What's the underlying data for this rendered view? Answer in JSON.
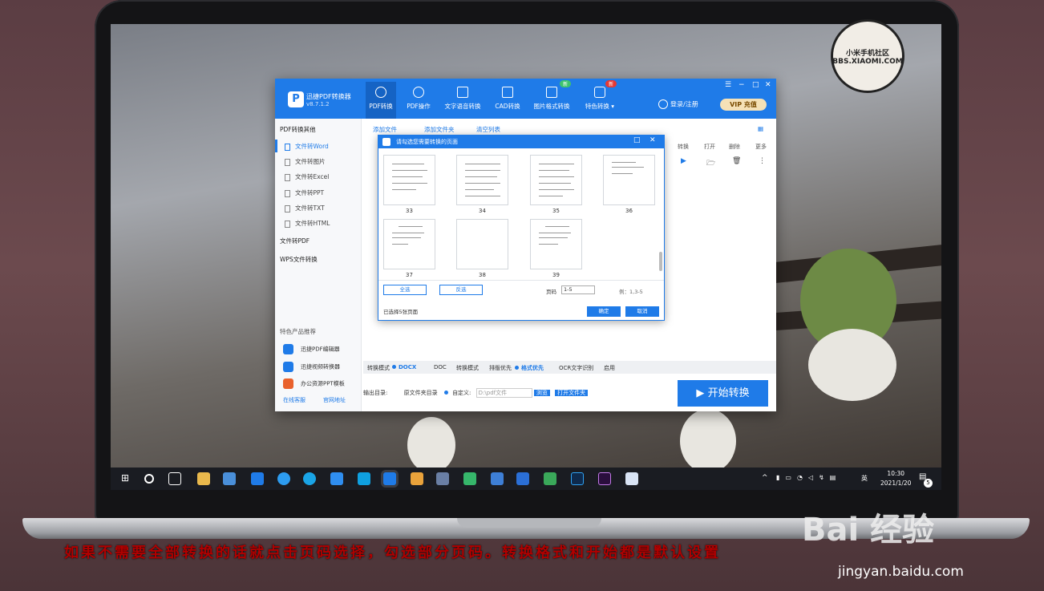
{
  "app": {
    "name": "迅捷PDF转换器",
    "version": "v8.7.1.2",
    "login": "登录/注册",
    "vip": "VIP 充值",
    "controls": [
      "☰",
      "−",
      "□",
      "✕"
    ]
  },
  "nav": [
    {
      "label": "PDF转换",
      "icon": "refresh-icon"
    },
    {
      "label": "PDF操作",
      "icon": "settings-icon"
    },
    {
      "label": "文字语音转换",
      "icon": "audio-icon"
    },
    {
      "label": "CAD转换",
      "icon": "cad-icon"
    },
    {
      "label": "图片格式转换",
      "icon": "image-icon"
    },
    {
      "label": "特色转换 ▾",
      "icon": "special-icon"
    }
  ],
  "nav_badges": [
    "新",
    "新"
  ],
  "sidebar": {
    "group1": "PDF转换其他",
    "items": [
      "文件转Word",
      "文件转图片",
      "文件转Excel",
      "文件转PPT",
      "文件转TXT",
      "文件转HTML"
    ],
    "group2": "文件转PDF",
    "group3": "WPS文件转换",
    "promo_title": "特色产品推荐",
    "products": [
      "迅捷PDF编辑器",
      "迅捷视频转换器",
      "办公资源PPT模板"
    ],
    "footer": [
      "在线客服",
      "官网地址"
    ]
  },
  "toolbar": {
    "add_file": "添加文件",
    "add_folder": "添加文件夹",
    "clear": "清空列表"
  },
  "columns": [
    "转换",
    "打开",
    "删除",
    "更多"
  ],
  "column_icons": [
    "▶",
    "🗁",
    "🗑",
    "⋮"
  ],
  "dialog": {
    "title": "请勾选您需要转换的页面",
    "pages": [
      "33",
      "34",
      "35",
      "36",
      "37",
      "38",
      "39"
    ],
    "btn_all": "全选",
    "btn_invert": "反选",
    "page_label": "页码",
    "page_value": "1-5",
    "example": "例：1,3-5",
    "selected_text": "已选择5张页面",
    "ok": "确定",
    "cancel": "取消"
  },
  "options": {
    "mode_label": "转换模式",
    "opt_docx": "DOCX",
    "opt_doc": "DOC",
    "mode_label2": "转换模式",
    "layout_first": "排版优先",
    "format_first": "格式优先",
    "ocr": "OCR文字识别",
    "apply": "启用"
  },
  "output": {
    "label": "输出目录:",
    "source": "原文件夹目录",
    "custom": "自定义:",
    "path": "D:\\pdf文件",
    "browse": "浏览",
    "open": "打开文件夹"
  },
  "start_button": "开始转换",
  "clock": {
    "time": "10:30",
    "date": "2021/1/20"
  },
  "tray_lang": "英",
  "notification_count": "5",
  "watermark_text": "小米手机社区 BBS.XIAOMI.COM",
  "caption": "如果不需要全部转换的话就点击页码选择，勾选部分页码。转换格式和开始都是默认设置",
  "site": {
    "logo": "Bai 经验",
    "url": "jingyan.baidu.com"
  },
  "colors": {
    "accent": "#1f7be8",
    "caption": "#b10000"
  }
}
